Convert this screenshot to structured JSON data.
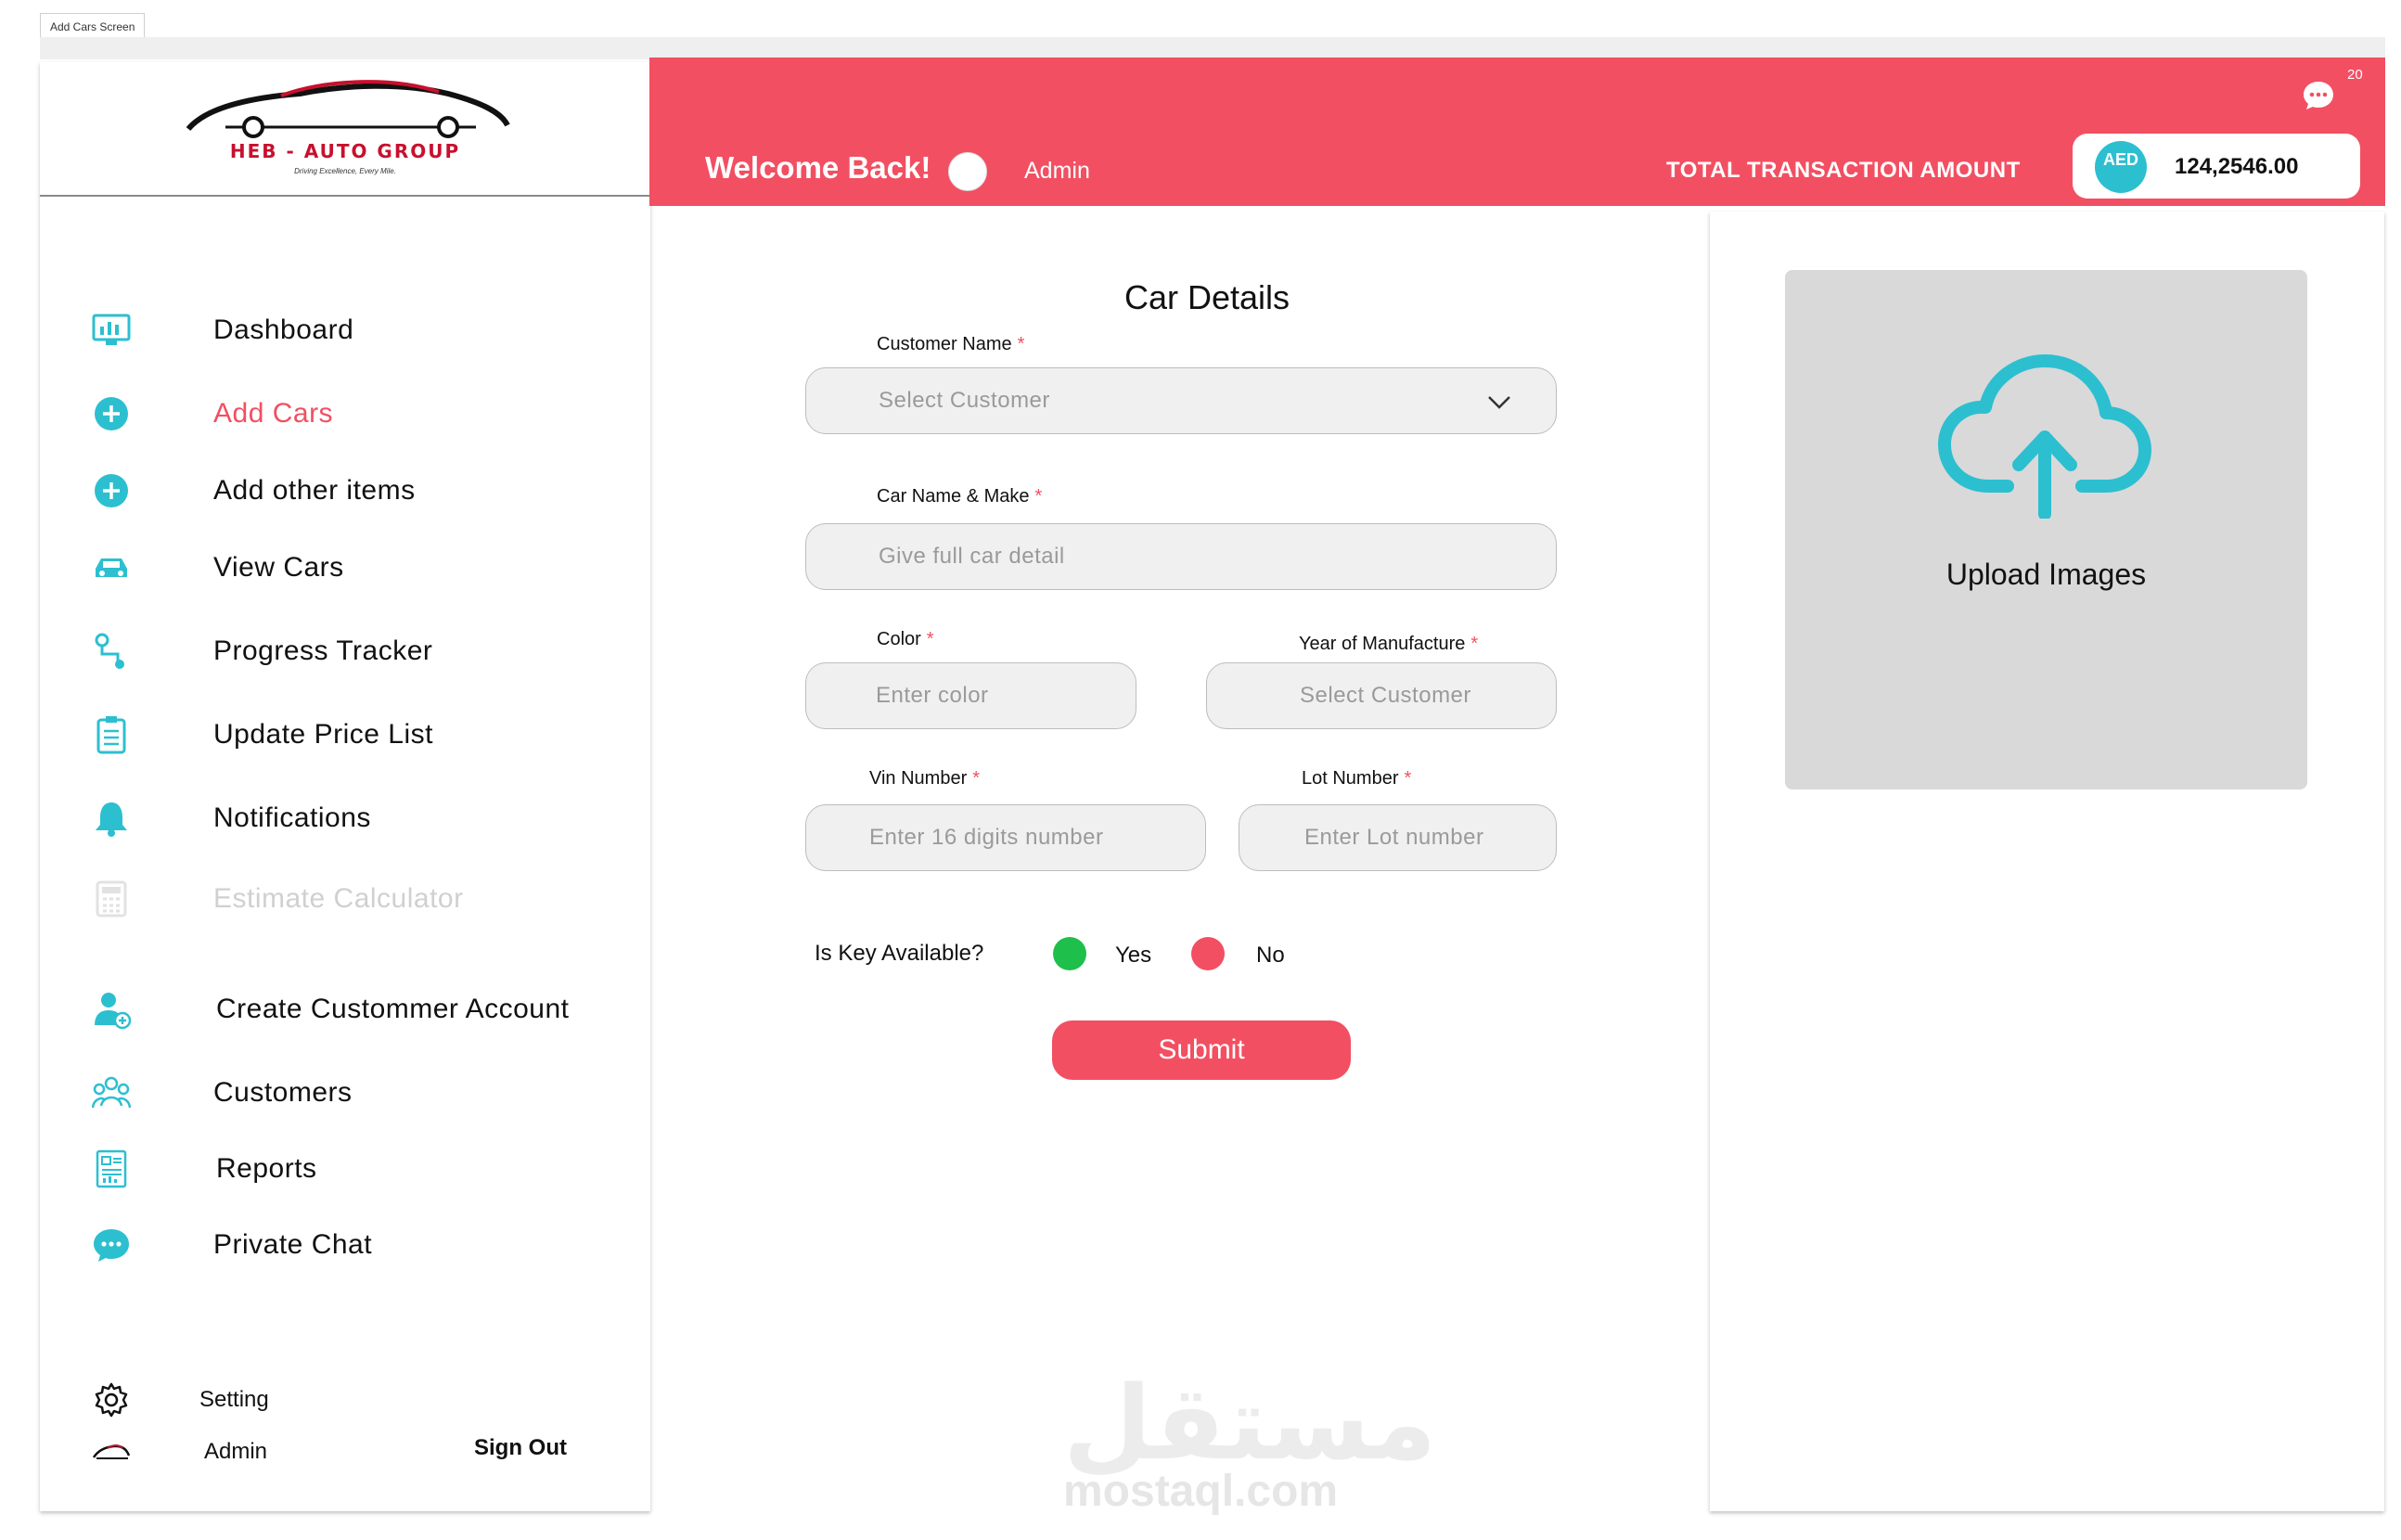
{
  "frame_label": "Add Cars Screen",
  "brand": {
    "name": "HEB - AUTO GROUP",
    "tagline": "Driving Excellence, Every Mile."
  },
  "sidebar": {
    "items": [
      {
        "label": "Dashboard",
        "icon": "dashboard-icon"
      },
      {
        "label": "Add Cars",
        "icon": "plus-circle-icon",
        "active": true
      },
      {
        "label": "Add other items",
        "icon": "plus-circle-icon"
      },
      {
        "label": "View Cars",
        "icon": "car-icon"
      },
      {
        "label": "Progress Tracker",
        "icon": "route-icon"
      },
      {
        "label": "Update Price List",
        "icon": "clipboard-list-icon"
      },
      {
        "label": "Notifications",
        "icon": "bell-icon"
      },
      {
        "label": "Estimate Calculator",
        "icon": "calculator-icon",
        "disabled": true
      },
      {
        "label": "Create Custommer Account",
        "icon": "user-plus-icon"
      },
      {
        "label": "Customers",
        "icon": "customers-group-icon"
      },
      {
        "label": "Reports",
        "icon": "report-icon"
      },
      {
        "label": "Private Chat",
        "icon": "chat-icon"
      }
    ],
    "footer": {
      "setting_label": "Setting",
      "user_label": "Admin",
      "signout_label": "Sign Out"
    }
  },
  "header": {
    "welcome": "Welcome Back!",
    "role": "Admin",
    "total_label": "TOTAL TRANSACTION AMOUNT",
    "currency": "AED",
    "amount": "124,2546.00",
    "chat_count": "20"
  },
  "form": {
    "title": "Car Details",
    "customer_name": {
      "label": "Customer Name",
      "placeholder": "Select Customer"
    },
    "car_name": {
      "label": "Car Name & Make",
      "placeholder": "Give full car detail"
    },
    "color": {
      "label": "Color",
      "placeholder": "Enter color"
    },
    "year": {
      "label": "Year of Manufacture",
      "placeholder": "Select Customer"
    },
    "vin": {
      "label": "Vin Number",
      "placeholder": "Enter 16 digits number"
    },
    "lot": {
      "label": "Lot Number",
      "placeholder": "Enter Lot number"
    },
    "required_mark": "*",
    "key_question": "Is Key Available?",
    "yes_label": "Yes",
    "no_label": "No",
    "submit_label": "Submit"
  },
  "upload": {
    "label": "Upload Images"
  },
  "watermark": {
    "arabic": "مستقل",
    "latin": "mostaql.com"
  },
  "colors": {
    "primary": "#f24f62",
    "accent": "#2cbfd0",
    "yes": "#1fbf4b",
    "no": "#f24f62"
  }
}
